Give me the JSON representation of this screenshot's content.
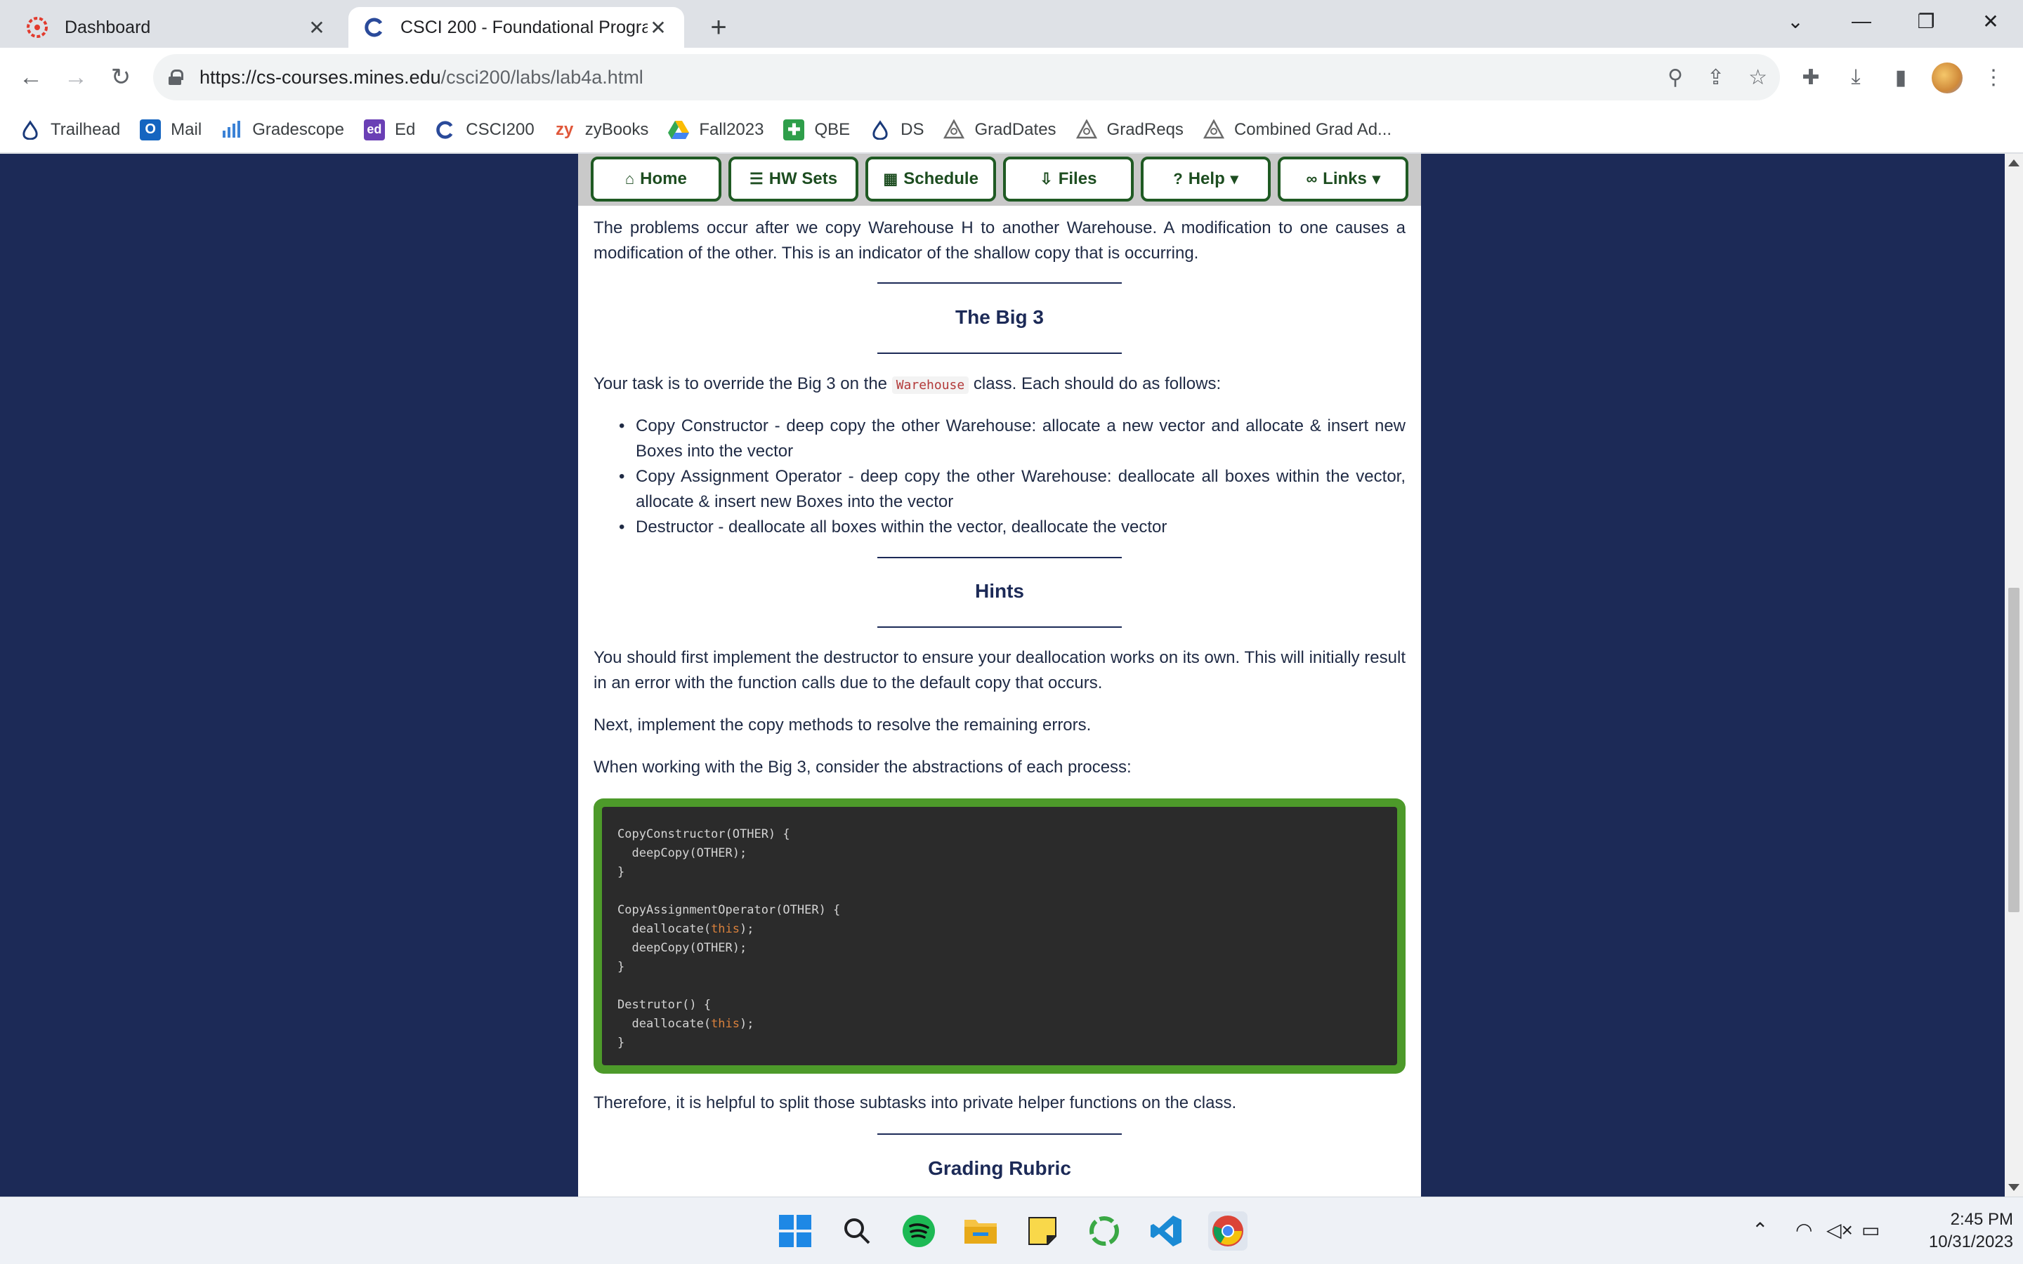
{
  "browser": {
    "tabs": [
      {
        "title": "Dashboard",
        "icon": "canvas-icon"
      },
      {
        "title": "CSCI 200 - Foundational Program",
        "icon": "csci-icon"
      }
    ],
    "url_host": "https://cs-courses.mines.edu",
    "url_path": "/csci200/labs/lab4a.html",
    "bookmarks": [
      {
        "label": "Trailhead",
        "icon": "trailhead-icon"
      },
      {
        "label": "Mail",
        "icon": "outlook-icon"
      },
      {
        "label": "Gradescope",
        "icon": "gradescope-icon"
      },
      {
        "label": "Ed",
        "icon": "ed-icon"
      },
      {
        "label": "CSCI200",
        "icon": "csci-icon"
      },
      {
        "label": "zyBooks",
        "icon": "zybooks-icon"
      },
      {
        "label": "Fall2023",
        "icon": "google-drive-icon"
      },
      {
        "label": "QBE",
        "icon": "qbe-icon"
      },
      {
        "label": "DS",
        "icon": "trailhead-icon"
      },
      {
        "label": "GradDates",
        "icon": "mines-icon"
      },
      {
        "label": "GradReqs",
        "icon": "mines-icon"
      },
      {
        "label": "Combined Grad Ad...",
        "icon": "mines-icon"
      }
    ]
  },
  "nav": {
    "home": "Home",
    "hw_sets": "HW Sets",
    "schedule": "Schedule",
    "files": "Files",
    "help": "Help",
    "links": "Links"
  },
  "page": {
    "intro": "The problems occur after we copy Warehouse H to another Warehouse. A modification to one causes a modification of the other. This is an indicator of the shallow copy that is occurring.",
    "big3_heading": "The Big 3",
    "task_pre": "Your task is to override the Big 3 on the",
    "task_code": "Warehouse",
    "task_post": "class. Each should do as follows:",
    "bullets": [
      "Copy Constructor - deep copy the other Warehouse: allocate a new vector and allocate & insert new Boxes into the vector",
      "Copy Assignment Operator - deep copy the other Warehouse: deallocate all boxes within the vector, allocate & insert new Boxes into the vector",
      "Destructor - deallocate all boxes within the vector, deallocate the vector"
    ],
    "hints_heading": "Hints",
    "hint1": "You should first implement the destructor to ensure your deallocation works on its own. This will initially result in an error with the function calls due to the default copy that occurs.",
    "hint2": "Next, implement the copy methods to resolve the remaining errors.",
    "hint3": "When working with the Big 3, consider the abstractions of each process:",
    "code": {
      "l1": "CopyConstructor(OTHER) {",
      "l2": "  deepCopy(OTHER);",
      "l3": "}",
      "l5": "CopyAssignmentOperator(OTHER) {",
      "l6a": "  deallocate(",
      "l6k": "this",
      "l6b": ");",
      "l7": "  deepCopy(OTHER);",
      "l8": "}",
      "l10": "Destrutor() {",
      "l11a": "  deallocate(",
      "l11k": "this",
      "l11b": ");",
      "l12": "}"
    },
    "after_code": "Therefore, it is helpful to split those subtasks into private helper functions on the class.",
    "rubric_heading": "Grading Rubric"
  },
  "taskbar": {
    "time": "2:45 PM",
    "date": "10/31/2023"
  }
}
